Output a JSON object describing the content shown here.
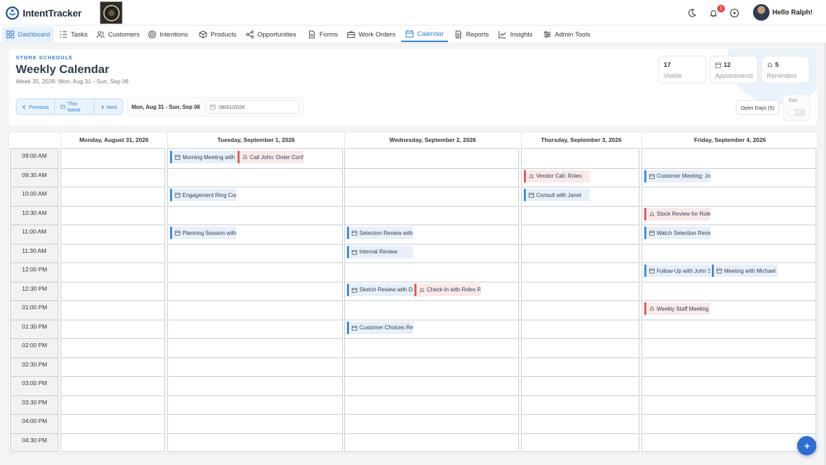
{
  "app": {
    "name": "IntentTracker"
  },
  "user": {
    "greeting": "Hello Ralph!",
    "notifications": "1"
  },
  "nav": [
    {
      "label": "Dashboard",
      "icon": "grid-icon"
    },
    {
      "label": "Tasks",
      "icon": "list-icon"
    },
    {
      "label": "Customers",
      "icon": "users-icon"
    },
    {
      "label": "Intentions",
      "icon": "target-icon"
    },
    {
      "label": "Products",
      "icon": "box-icon"
    },
    {
      "label": "Opportunities",
      "icon": "share-icon"
    },
    {
      "label": "Forms",
      "icon": "file-icon"
    },
    {
      "label": "Work Orders",
      "icon": "briefcase-icon"
    },
    {
      "label": "Calendar",
      "icon": "calendar-icon"
    },
    {
      "label": "Reports",
      "icon": "report-icon"
    },
    {
      "label": "Insights",
      "icon": "chart-icon"
    },
    {
      "label": "Admin Tools",
      "icon": "sliders-icon"
    }
  ],
  "header": {
    "eyebrow": "STORE SCHEDULE",
    "title": "Weekly Calendar",
    "subtitle": "Week 35, 2026: Mon, Aug 31 - Sun, Sep 06",
    "stats": [
      {
        "value": "17",
        "label": "Visible"
      },
      {
        "value": "12",
        "label": "Appointments"
      },
      {
        "value": "5",
        "label": "Reminders"
      }
    ],
    "prev_label": "Previous",
    "this_week_label": "This Week",
    "next_label": "Next",
    "range_text": "Mon, Aug 31 - Sun, Sep 06",
    "date_value": "08/31/2026",
    "open_days_label": "Open Days (5)",
    "edit_label": "Edit",
    "toggle_label": "Off"
  },
  "calendar": {
    "days": [
      "Monday, August 31, 2026",
      "Tuesday, September 1, 2026",
      "Wednesday, September 2, 2026",
      "Thursday, September 3, 2026",
      "Friday, September 4, 2026"
    ],
    "times": [
      "09:00 AM",
      "09:30 AM",
      "10:00 AM",
      "10:30 AM",
      "11:00 AM",
      "11:30 AM",
      "12:00 PM",
      "12:30 PM",
      "01:00 PM",
      "01:30 PM",
      "02:00 PM",
      "02:30 PM",
      "03:00 PM",
      "03:30 PM",
      "04:00 PM",
      "04:30 PM"
    ],
    "events": [
      {
        "day": 1,
        "slot": 0,
        "lane": 0,
        "type": "appointment",
        "title": "Morning Meeting with"
      },
      {
        "day": 1,
        "slot": 0,
        "lane": 1,
        "type": "reminder",
        "title": "Call John: Order Confi"
      },
      {
        "day": 1,
        "slot": 2,
        "lane": 0,
        "type": "appointment",
        "title": "Engagement Ring Con"
      },
      {
        "day": 1,
        "slot": 4,
        "lane": 0,
        "type": "appointment",
        "title": "Planning Session with"
      },
      {
        "day": 2,
        "slot": 4,
        "lane": 0,
        "type": "appointment",
        "title": "Selection Review with"
      },
      {
        "day": 2,
        "slot": 5,
        "lane": 0,
        "type": "appointment",
        "title": "Internal Review"
      },
      {
        "day": 2,
        "slot": 7,
        "lane": 0,
        "type": "appointment",
        "title": "Sketch Review with De"
      },
      {
        "day": 2,
        "slot": 7,
        "lane": 1,
        "type": "reminder",
        "title": "Check-In with Rolex Re"
      },
      {
        "day": 2,
        "slot": 9,
        "lane": 0,
        "type": "appointment",
        "title": "Customer Choices Rev"
      },
      {
        "day": 3,
        "slot": 1,
        "lane": 0,
        "type": "reminder",
        "title": "Vendor Call: Rolex"
      },
      {
        "day": 3,
        "slot": 2,
        "lane": 0,
        "type": "appointment",
        "title": "Consult with Janet"
      },
      {
        "day": 4,
        "slot": 1,
        "lane": 0,
        "type": "appointment",
        "title": "Customer Meeting: Jo"
      },
      {
        "day": 4,
        "slot": 3,
        "lane": 0,
        "type": "reminder",
        "title": "Stock Review for Rolex"
      },
      {
        "day": 4,
        "slot": 4,
        "lane": 0,
        "type": "appointment",
        "title": "Watch Selection Revie"
      },
      {
        "day": 4,
        "slot": 6,
        "lane": 0,
        "type": "appointment",
        "title": "Follow-Up with John S"
      },
      {
        "day": 4,
        "slot": 6,
        "lane": 1,
        "type": "appointment",
        "title": "Meeting with Michael"
      },
      {
        "day": 4,
        "slot": 8,
        "lane": 0,
        "type": "reminder",
        "title": "Weekly Staff Meeting"
      }
    ]
  },
  "colors": {
    "accent": "#2b7fd4",
    "appointment": "#3b8fd9",
    "reminder": "#e05a5a"
  }
}
